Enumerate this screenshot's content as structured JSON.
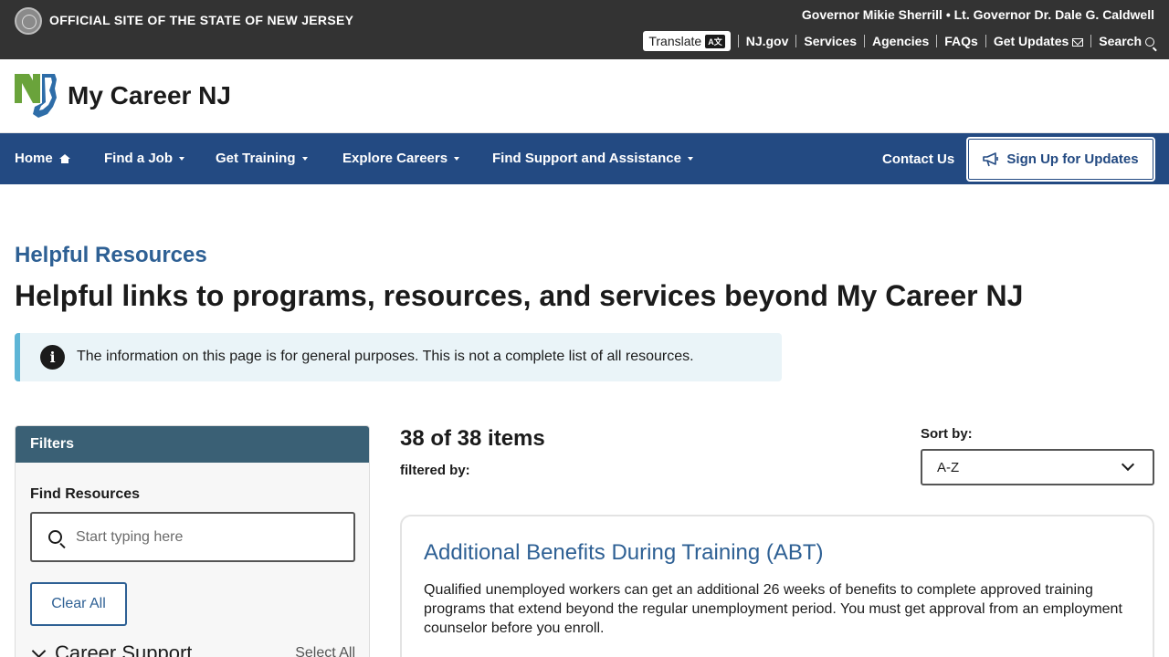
{
  "statebar": {
    "official_label": "OFFICIAL SITE OF THE STATE OF NEW JERSEY",
    "governor_line": "Governor Mikie Sherrill • Lt. Governor Dr. Dale G. Caldwell",
    "translate_label": "Translate",
    "translate_badge": "A文",
    "links": [
      "NJ.gov",
      "Services",
      "Agencies",
      "FAQs",
      "Get Updates",
      "Search"
    ]
  },
  "brand": {
    "site_name": "My Career NJ",
    "logo_colors": {
      "green": "#6aa33b",
      "blue": "#2e6da8"
    }
  },
  "nav": {
    "home": "Home",
    "find_job": "Find a Job",
    "get_training": "Get Training",
    "explore_careers": "Explore Careers",
    "find_support": "Find Support and Assistance",
    "contact": "Contact Us",
    "signup": "Sign Up for Updates"
  },
  "page": {
    "eyebrow": "Helpful Resources",
    "headline": "Helpful links to programs, resources, and services beyond My Career NJ",
    "alert_text": "The information on this page is for general purposes. This is not a complete list of all resources."
  },
  "filters": {
    "title": "Filters",
    "find_label": "Find Resources",
    "search_placeholder": "Start typing here",
    "clear_all": "Clear All",
    "category": "Career Support",
    "select_all": "Select All"
  },
  "results": {
    "count": "38 of 38 items",
    "filtered_by": "filtered by:",
    "sort_label": "Sort by:",
    "sort_value": "A-Z",
    "items": [
      {
        "title": "Additional Benefits During Training (ABT)",
        "description": "Qualified unemployed workers can get an additional 26 weeks of benefits to complete approved training programs that extend beyond the regular unemployment period. You must get approval from an employment counselor before you enroll."
      }
    ]
  },
  "colors": {
    "statebar_bg": "#333333",
    "nav_bg": "#234a82",
    "link_blue": "#2e6094",
    "filter_head": "#3a6075",
    "alert_bg": "#eaf4f8",
    "alert_border": "#5eb5d6"
  }
}
